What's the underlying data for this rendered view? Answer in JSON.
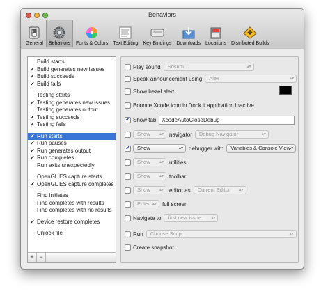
{
  "window": {
    "title": "Behaviors"
  },
  "toolbar": {
    "items": [
      {
        "label": "General",
        "icon": "general-switch-icon"
      },
      {
        "label": "Behaviors",
        "icon": "gear-icon"
      },
      {
        "label": "Fonts & Colors",
        "icon": "color-wheel-icon"
      },
      {
        "label": "Text Editing",
        "icon": "text-editing-icon"
      },
      {
        "label": "Key Bindings",
        "icon": "keyboard-icon"
      },
      {
        "label": "Downloads",
        "icon": "downloads-icon"
      },
      {
        "label": "Locations",
        "icon": "locations-icon"
      },
      {
        "label": "Distributed Builds",
        "icon": "distributed-builds-icon"
      }
    ],
    "selected": "Behaviors"
  },
  "sidebar": {
    "groups": [
      [
        {
          "label": "Build starts",
          "checked": false
        },
        {
          "label": "Build generates new issues",
          "checked": true
        },
        {
          "label": "Build succeeds",
          "checked": true
        },
        {
          "label": "Build fails",
          "checked": true
        }
      ],
      [
        {
          "label": "Testing starts",
          "checked": false
        },
        {
          "label": "Testing generates new issues",
          "checked": true
        },
        {
          "label": "Testing generates output",
          "checked": false
        },
        {
          "label": "Testing succeeds",
          "checked": true
        },
        {
          "label": "Testing fails",
          "checked": true
        }
      ],
      [
        {
          "label": "Run starts",
          "checked": true,
          "selected": true
        },
        {
          "label": "Run pauses",
          "checked": true
        },
        {
          "label": "Run generates output",
          "checked": true
        },
        {
          "label": "Run completes",
          "checked": true
        },
        {
          "label": "Run exits unexpectedly",
          "checked": false
        }
      ],
      [
        {
          "label": "OpenGL ES capture starts",
          "checked": false
        },
        {
          "label": "OpenGL ES capture completes",
          "checked": true
        }
      ],
      [
        {
          "label": "Find initiates",
          "checked": false
        },
        {
          "label": "Find completes with results",
          "checked": false
        },
        {
          "label": "Find completes with no results",
          "checked": false
        }
      ],
      [
        {
          "label": "Device restore completes",
          "checked": true
        }
      ],
      [
        {
          "label": "Unlock file",
          "checked": false
        }
      ]
    ],
    "add_label": "+",
    "remove_label": "−"
  },
  "panel": {
    "play_sound": {
      "label": "Play sound",
      "checked": false,
      "value": "Sosumi"
    },
    "speak": {
      "label": "Speak announcement using",
      "checked": false,
      "value": "Alex"
    },
    "bezel": {
      "label": "Show bezel alert",
      "checked": false
    },
    "bounce": {
      "label": "Bounce Xcode icon in Dock if application inactive",
      "checked": false
    },
    "show_tab": {
      "label": "Show tab",
      "checked": true,
      "value": "XcodeAutoCloseDebug"
    },
    "navigator": {
      "mode": "Show",
      "label": "navigator",
      "value": "Debug Navigator",
      "checked": false
    },
    "debugger": {
      "mode": "Show",
      "label": "debugger with",
      "value": "Variables & Console View",
      "checked": true
    },
    "utilities": {
      "mode": "Show",
      "label": "utilities",
      "checked": false
    },
    "toolbar_row": {
      "mode": "Show",
      "label": "toolbar",
      "checked": false
    },
    "editor": {
      "mode": "Show",
      "label": "editor as",
      "value": "Current Editor",
      "checked": false
    },
    "fullscreen": {
      "mode": "Enter",
      "label": "full screen",
      "checked": false
    },
    "navigate": {
      "label": "Navigate to",
      "value": "first new issue",
      "checked": false
    },
    "run": {
      "label": "Run",
      "value": "Choose Script...",
      "checked": false
    },
    "snapshot": {
      "label": "Create snapshot",
      "checked": false
    }
  }
}
